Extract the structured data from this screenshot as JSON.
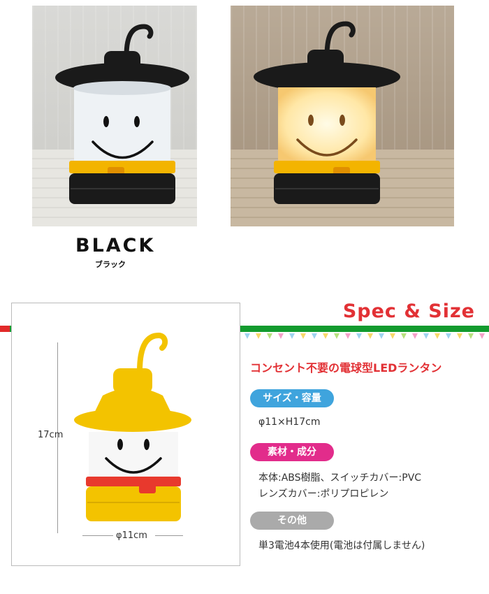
{
  "variant": {
    "name": "BLACK",
    "name_kana": "ブラック"
  },
  "photos": [
    {
      "label": "light-off",
      "face": "smiley"
    },
    {
      "label": "light-on",
      "face": "smiley"
    }
  ],
  "dimensions": {
    "height_label": "17cm",
    "width_label": "φ11cm"
  },
  "spec": {
    "title": "Spec & Size",
    "tagline": "コンセント不要の電球型LEDランタン",
    "size_heading": "サイズ・容量",
    "size_value": "φ11×H17cm",
    "material_heading": "素材・成分",
    "material_line1": "本体:ABS樹脂、スイッチカバー:PVC",
    "material_line2": "レンズカバー:ポリプロピレン",
    "other_heading": "その他",
    "other_value": "単3電池4本使用(電池は付属しません)"
  },
  "colors": {
    "accent_red": "#e23135",
    "band_green": "#129b2e",
    "pill_blue": "#3fa4dd",
    "pill_pink": "#e22c8b",
    "pill_gray": "#aaaaaa",
    "lantern_black": "#1a1a1a",
    "lantern_yellow": "#f3c300"
  }
}
